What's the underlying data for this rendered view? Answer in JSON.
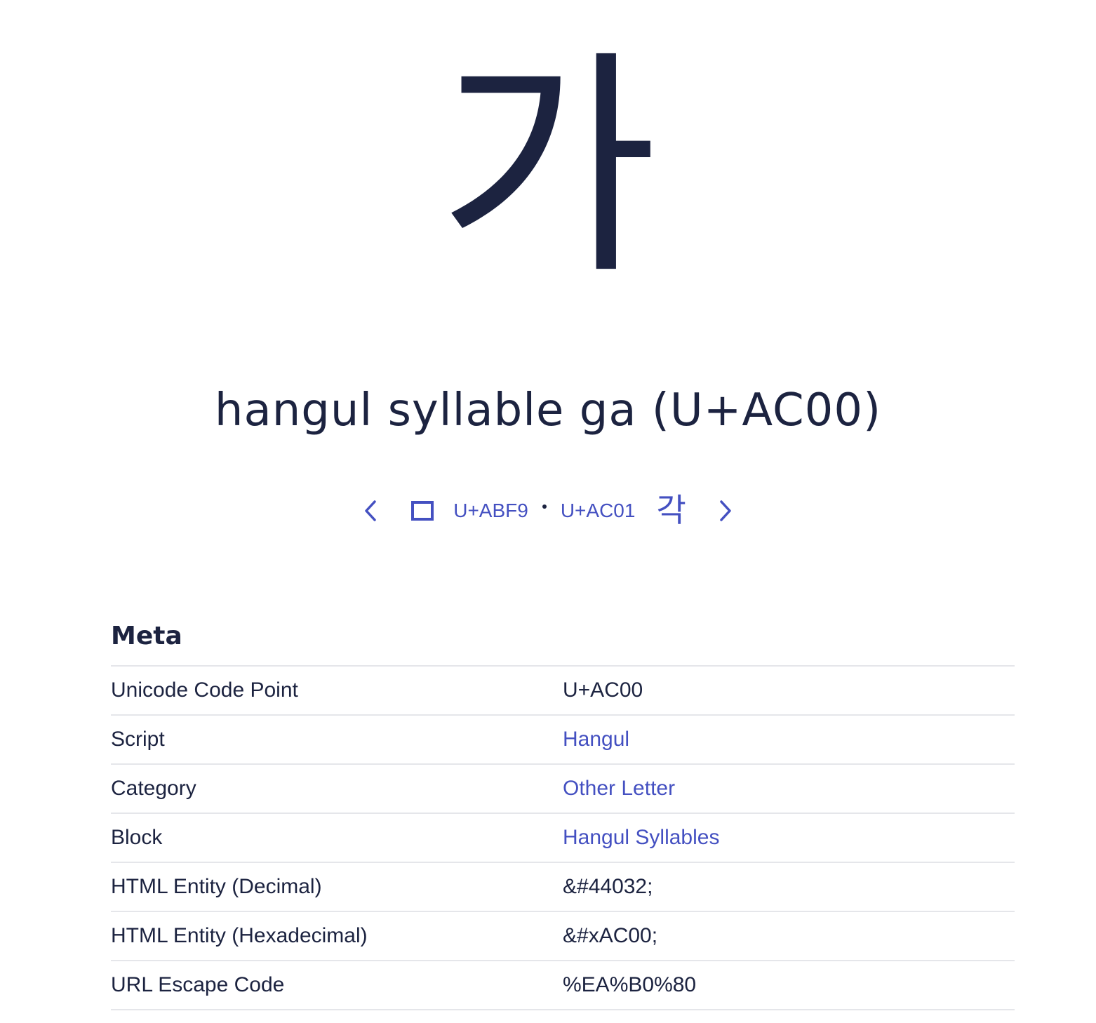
{
  "character": "가",
  "title": "hangul syllable ga (U+AC00)",
  "nav": {
    "prev_code": "U+ABF9",
    "next_code": "U+AC01",
    "next_char": "각",
    "separator": "•"
  },
  "meta": {
    "heading": "Meta",
    "rows": [
      {
        "label": "Unicode Code Point",
        "value": "U+AC00",
        "link": false
      },
      {
        "label": "Script",
        "value": "Hangul",
        "link": true
      },
      {
        "label": "Category",
        "value": "Other Letter",
        "link": true
      },
      {
        "label": "Block",
        "value": "Hangul Syllables",
        "link": true
      },
      {
        "label": "HTML Entity (Decimal)",
        "value": "&#44032;",
        "link": false
      },
      {
        "label": "HTML Entity (Hexadecimal)",
        "value": "&#xAC00;",
        "link": false
      },
      {
        "label": "URL Escape Code",
        "value": "%EA%B0%80",
        "link": false
      }
    ]
  },
  "colors": {
    "text": "#1c2340",
    "accent": "#4450c1",
    "divider": "#e5e6ea"
  }
}
